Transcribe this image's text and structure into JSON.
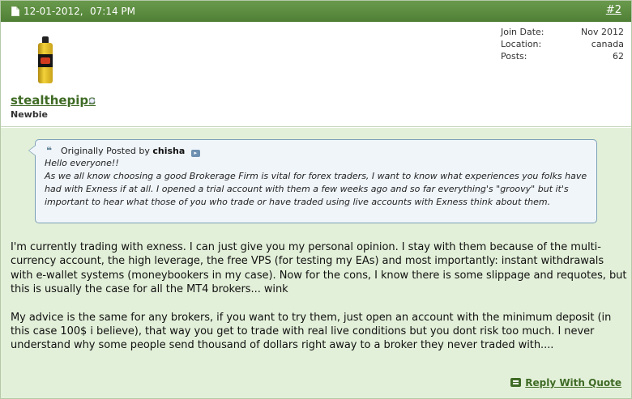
{
  "header": {
    "date": "12-01-2012,",
    "time": "07:14 PM",
    "post_number": "#2"
  },
  "user": {
    "name": "stealthepips",
    "title": "Newbie",
    "stats": [
      {
        "label": "Join Date:",
        "value": "Nov 2012"
      },
      {
        "label": "Location:",
        "value": "canada"
      },
      {
        "label": "Posts:",
        "value": "62"
      }
    ]
  },
  "quote": {
    "prefix": "Originally Posted by",
    "author": "chisha",
    "lines": [
      "Hello everyone!!",
      "As we all know choosing a good Brokerage Firm is vital for forex traders, I want to know what experiences you folks have had with Exness if at all. I opened a trial account with them a few weeks ago and so far everything's \"groovy\" but it's important to hear what those of you who trade or have traded using live accounts with Exness think about them."
    ]
  },
  "message": {
    "paragraphs": [
      "I'm currently trading with exness. I can just give you my personal opinion. I stay with them because of the multi-currency account, the high leverage, the free VPS (for testing my EAs) and most importantly: instant withdrawals with e-wallet systems (moneybookers in my case). Now for the cons, I know there is some slippage and requotes, but this is usually the case for all the MT4 brokers... wink",
      "My advice is the same for any brokers, if you want to try them, just open an account with the minimum deposit (in this case 100$ i believe), that way you get to trade with real live conditions but you dont risk too much. I never understand why some people send thousand of dollars right away to a broker they never traded with...."
    ]
  },
  "actions": {
    "reply_with_quote": "Reply With Quote"
  },
  "colors": {
    "header_bg": "#5a8a3e",
    "content_bg": "#e3f0d9",
    "quote_bg": "#f0f5fa",
    "link_green": "#3f6b25"
  }
}
